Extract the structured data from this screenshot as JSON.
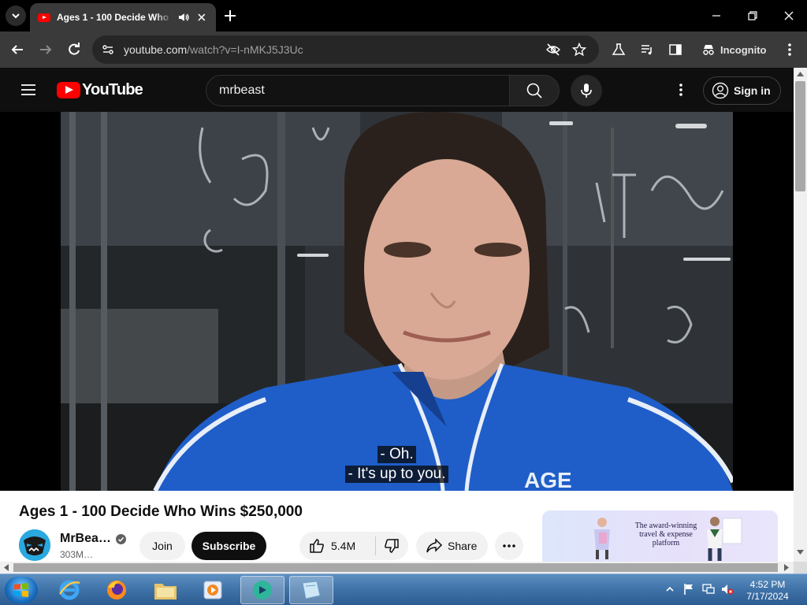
{
  "browser": {
    "tab_title": "Ages 1 - 100 Decide Who Wins $250,000 - YouTube",
    "url_host": "youtube.com",
    "url_rest": "/watch?v=I-nMKJ5J3Uc",
    "profile_label": "Incognito"
  },
  "youtube": {
    "logo_text": "YouTube",
    "search_query": "mrbeast",
    "signin_label": "Sign in"
  },
  "video": {
    "caption_line1": "- Oh.",
    "caption_line2": "- It's up to you.",
    "jacket_text": "AGE"
  },
  "details": {
    "title": "Ages 1 - 100 Decide Who Wins $250,000",
    "channel_name": "MrBea…",
    "subscribers": "303M…",
    "join_label": "Join",
    "subscribe_label": "Subscribe",
    "likes": "5.4M",
    "share_label": "Share"
  },
  "ad": {
    "text": "The award-winning travel & expense platform"
  },
  "taskbar": {
    "time": "4:52 PM",
    "date": "7/17/2024"
  },
  "colors": {
    "youtube_red": "#ff0000",
    "jacket_blue": "#1f5ec8",
    "taskbar_blue": "#3f72a8"
  }
}
